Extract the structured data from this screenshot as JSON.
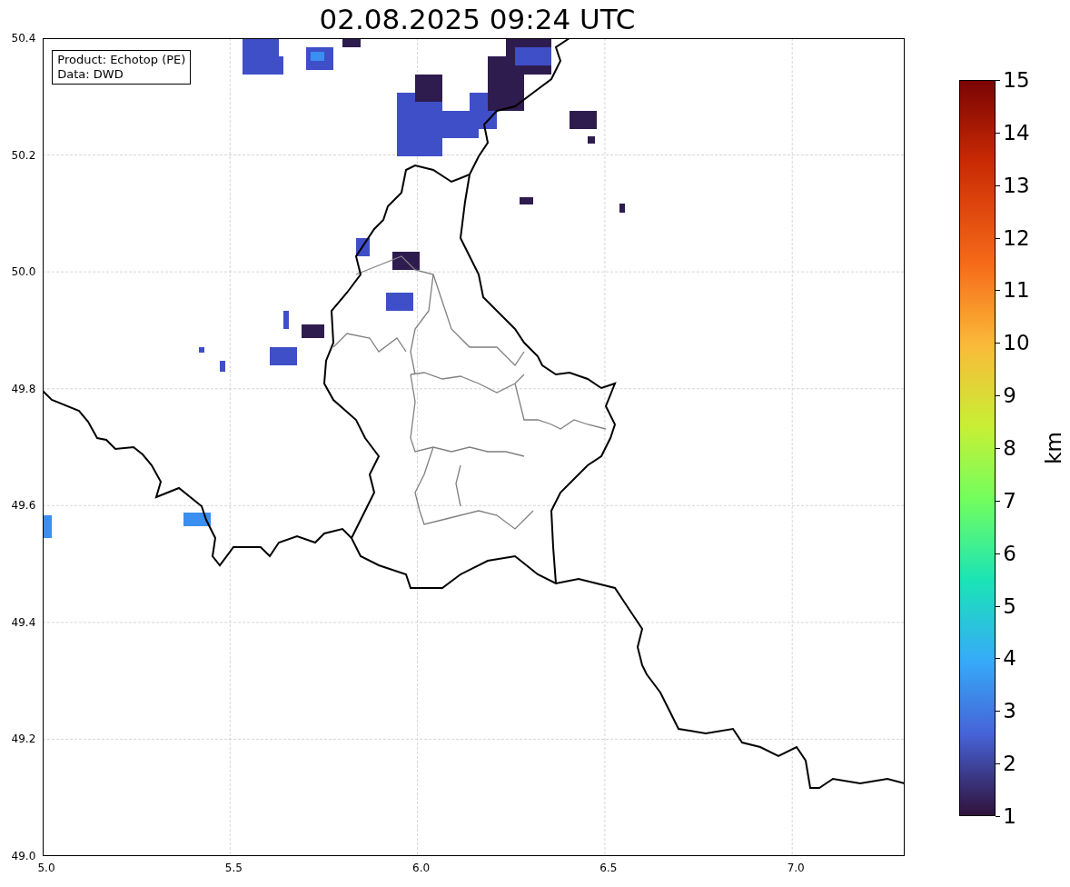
{
  "title": "02.08.2025 09:24 UTC",
  "info_box": {
    "lines": [
      "Product: Echotop (PE)",
      "Data: DWD"
    ]
  },
  "map": {
    "y_ticks": [
      "50.4",
      "50.2",
      "50.0",
      "49.8",
      "49.6",
      "49.4",
      "49.2",
      "49.0"
    ],
    "x_ticks": [
      "5.0",
      "5.5",
      "6.0",
      "6.5",
      "7.0"
    ]
  },
  "colorbar": {
    "ticks": [
      "15",
      "14",
      "13",
      "12",
      "11",
      "10",
      "9",
      "8",
      "7",
      "6",
      "5",
      "4",
      "3",
      "2",
      "1"
    ],
    "label": "km"
  }
}
